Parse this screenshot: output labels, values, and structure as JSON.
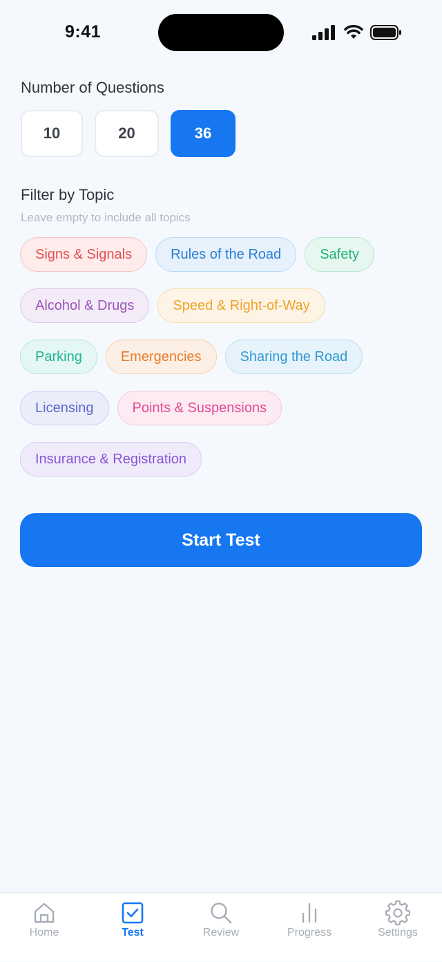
{
  "status_bar": {
    "time": "9:41"
  },
  "question_count": {
    "title": "Number of Questions",
    "options": [
      "10",
      "20",
      "36"
    ],
    "selected": "36"
  },
  "topic_filter": {
    "title": "Filter by Topic",
    "hint": "Leave empty to include all topics",
    "topics": [
      {
        "label": "Signs & Signals",
        "text_color": "#e0514f",
        "bg": "#fdeceb",
        "border": "#f5c5c2"
      },
      {
        "label": "Rules of the Road",
        "text_color": "#2a7fd3",
        "bg": "#e6f1fc",
        "border": "#b9d8f5"
      },
      {
        "label": "Safety",
        "text_color": "#23b07c",
        "bg": "#e6f7f0",
        "border": "#b7e6d2"
      },
      {
        "label": "Alcohol & Drugs",
        "text_color": "#9b56b8",
        "bg": "#f3ebf8",
        "border": "#dcc6ea"
      },
      {
        "label": "Speed & Right-of-Way",
        "text_color": "#f0a22a",
        "bg": "#fdf4e6",
        "border": "#f7dcae"
      },
      {
        "label": "Parking",
        "text_color": "#1fb596",
        "bg": "#e5f7f2",
        "border": "#b4e7da"
      },
      {
        "label": "Emergencies",
        "text_color": "#e77c2a",
        "bg": "#fcefe5",
        "border": "#f4d0b0"
      },
      {
        "label": "Sharing the Road",
        "text_color": "#3298d3",
        "bg": "#e6f3fb",
        "border": "#b9dcf1"
      },
      {
        "label": "Licensing",
        "text_color": "#5b68cc",
        "bg": "#ebedfa",
        "border": "#c9cff1"
      },
      {
        "label": "Points & Suspensions",
        "text_color": "#e44a94",
        "bg": "#fcebf3",
        "border": "#f4c3dc"
      },
      {
        "label": "Insurance & Registration",
        "text_color": "#8a54d6",
        "bg": "#f0ebfb",
        "border": "#d8c9f3"
      }
    ]
  },
  "start_button": {
    "label": "Start Test",
    "color": "#1677f0"
  },
  "tab_bar": {
    "tabs": [
      {
        "label": "Home",
        "icon": "home-icon"
      },
      {
        "label": "Test",
        "icon": "checkbox-icon"
      },
      {
        "label": "Review",
        "icon": "search-icon"
      },
      {
        "label": "Progress",
        "icon": "bar-chart-icon"
      },
      {
        "label": "Settings",
        "icon": "gear-icon"
      }
    ],
    "active": "Test",
    "active_color": "#1677f0",
    "inactive_color": "#a7adb5"
  }
}
